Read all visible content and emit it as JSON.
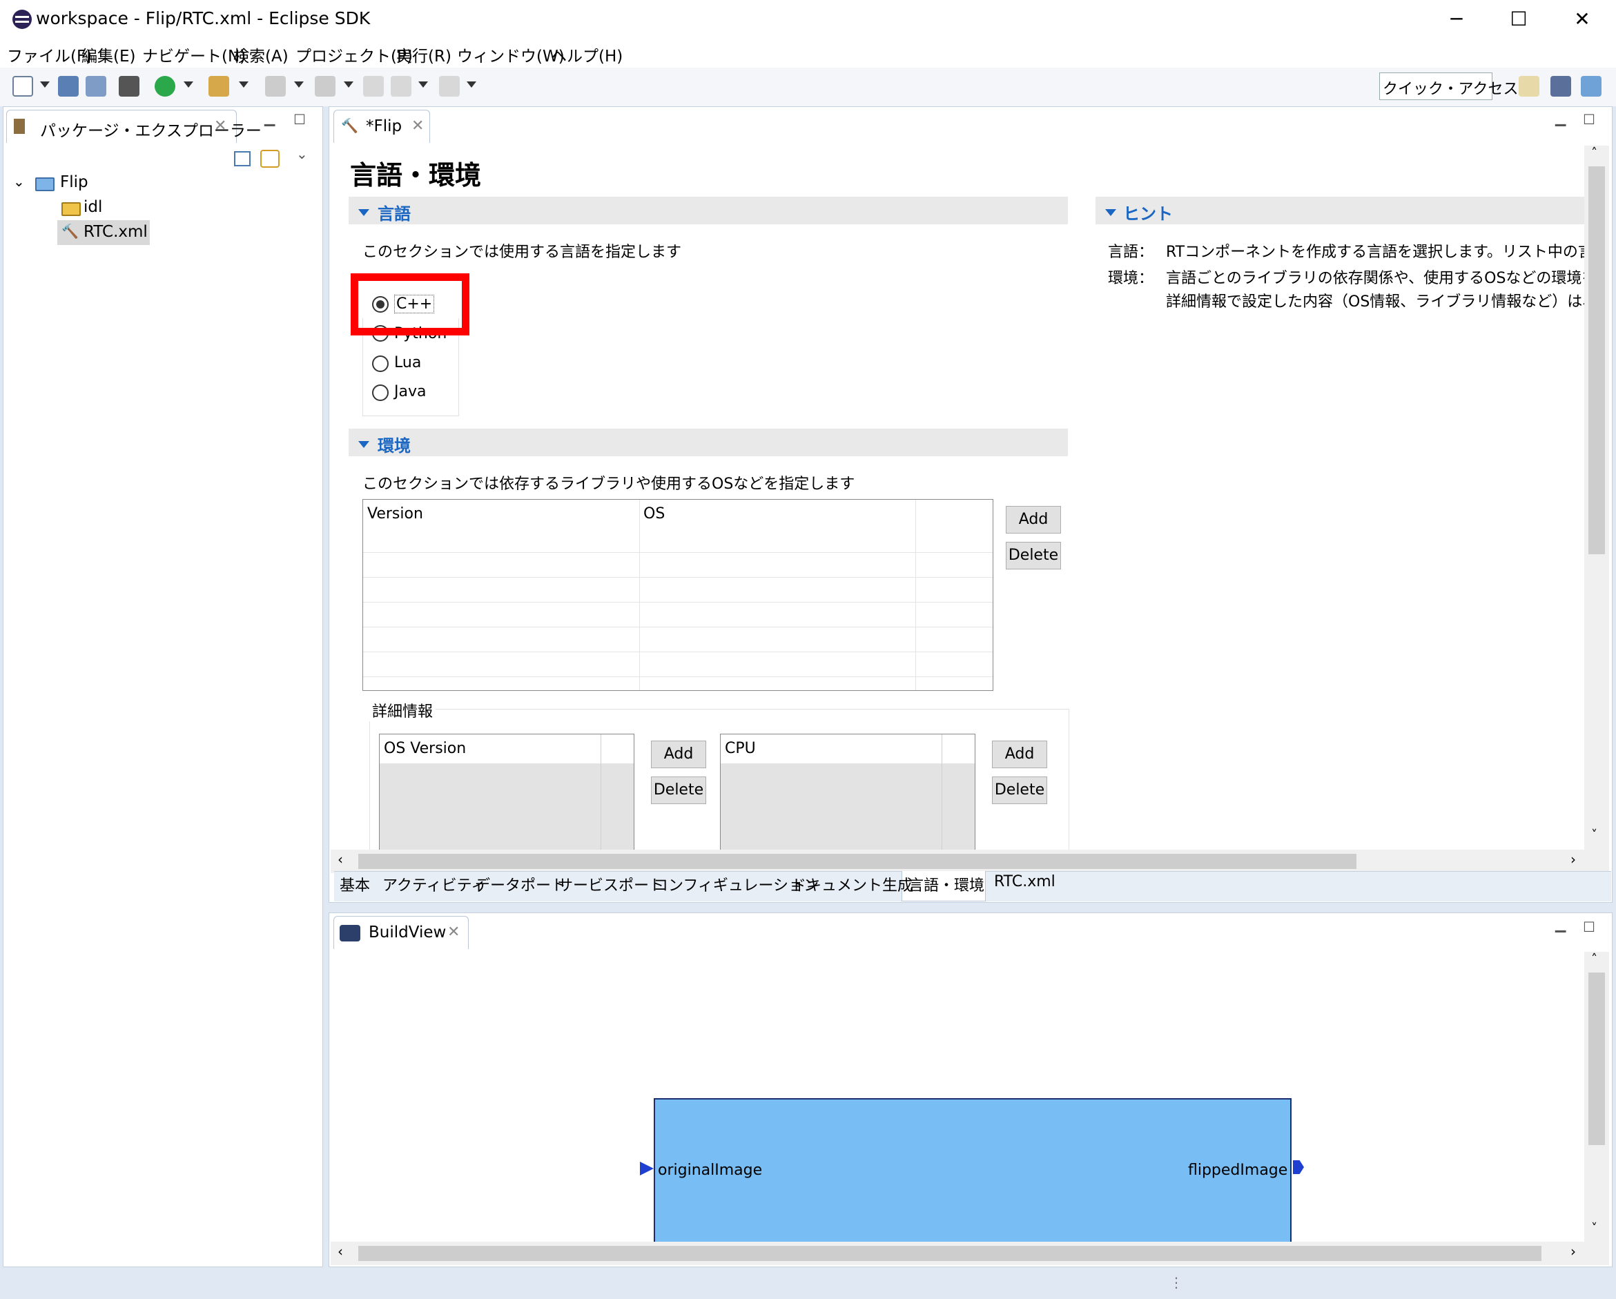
{
  "window": {
    "title": "workspace - Flip/RTC.xml - Eclipse SDK",
    "controls": {
      "minimize": "─",
      "maximize": "☐",
      "close": "✕"
    }
  },
  "menu": [
    "ファイル(F)",
    "編集(E)",
    "ナビゲート(N)",
    "検索(A)",
    "プロジェクト(P)",
    "実行(R)",
    "ウィンドウ(W)",
    "ヘルプ(H)"
  ],
  "toolbar": {
    "quick_access": "クイック・アクセス"
  },
  "explorer": {
    "tab_label": "パッケージ・エクスプローラー",
    "tree": {
      "project": "Flip",
      "folder": "idl",
      "file": "RTC.xml"
    }
  },
  "editor": {
    "tab_label": "*Flip",
    "page_title": "言語・環境",
    "language_section": {
      "title": "言語",
      "description": "このセクションでは使用する言語を指定します",
      "options": [
        "C++",
        "Python",
        "Lua",
        "Java"
      ],
      "selected": "C++"
    },
    "hint_section": {
      "title": "ヒント",
      "lines": [
        {
          "key": "言語：",
          "text": "RTコンポーネントを作成する言語を選択します。リスト中の言語から"
        },
        {
          "key": "環境：",
          "text": "言語ごとのライブラリの依存関係や、使用するOSなどの環境を選択"
        },
        {
          "key": "",
          "text": "詳細情報で設定した内容（OS情報、ライブラリ情報など）は、フ"
        }
      ]
    },
    "env_section": {
      "title": "環境",
      "description": "このセクションでは依存するライブラリや使用するOSなどを指定します",
      "columns": [
        "Version",
        "OS"
      ],
      "add": "Add",
      "delete": "Delete",
      "details": {
        "label": "詳細情報",
        "os_version_header": "OS Version",
        "cpu_header": "CPU",
        "add": "Add",
        "delete": "Delete"
      }
    },
    "bottom_tabs": [
      "基本",
      "アクティビティ",
      "データポート",
      "サービスポート",
      "コンフィギュレーション",
      "ドキュメント生成",
      "言語・環境",
      "RTC.xml"
    ],
    "active_bottom_tab": "言語・環境"
  },
  "build_view": {
    "tab_label": "BuildView",
    "component": {
      "in_port": "originalImage",
      "out_port": "flippedImage"
    }
  },
  "colors": {
    "highlight": "#ff0000",
    "component_fill": "#78bdf3",
    "port": "#1f3fd1",
    "accent": "#1a66c2"
  }
}
